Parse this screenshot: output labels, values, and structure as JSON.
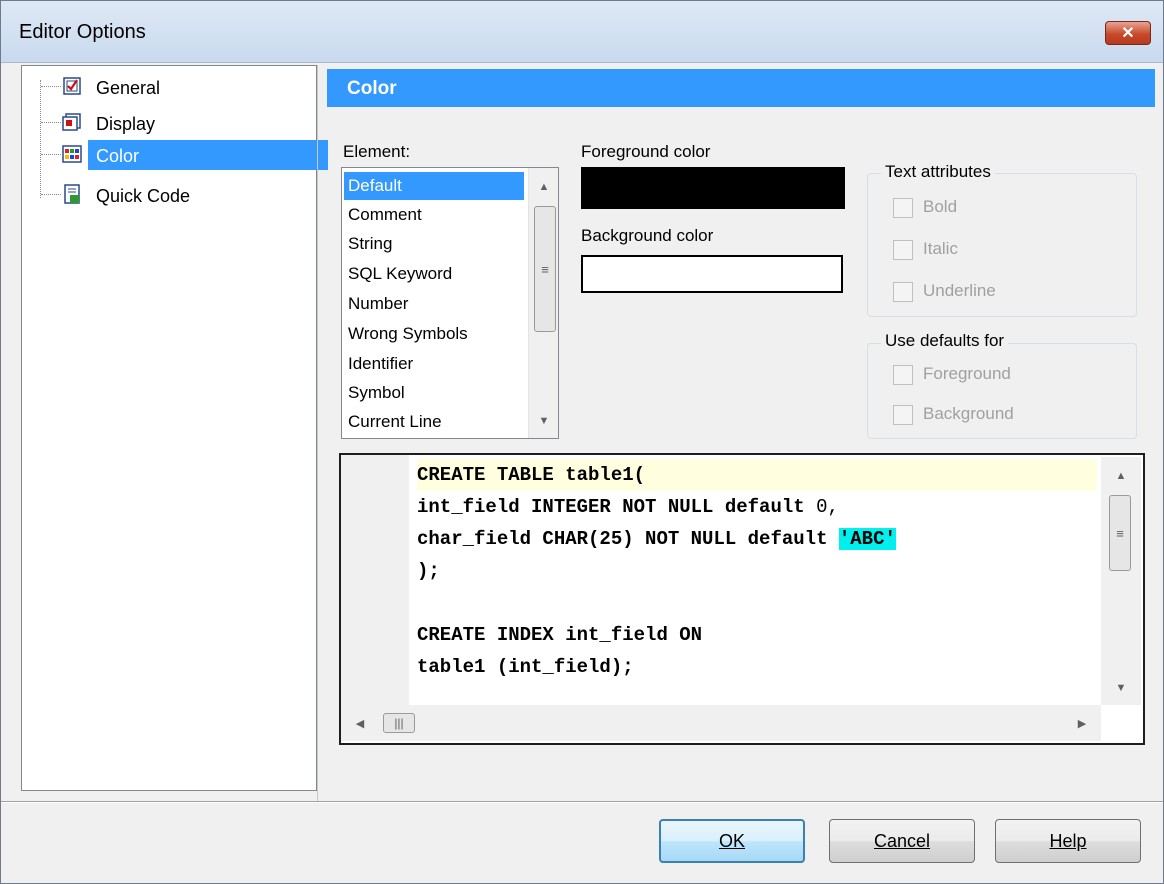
{
  "window": {
    "title": "Editor Options",
    "close_glyph": "✕"
  },
  "tree": {
    "items": [
      {
        "label": "General",
        "icon": "checkbox-page-icon"
      },
      {
        "label": "Display",
        "icon": "display-page-icon"
      },
      {
        "label": "Color",
        "icon": "color-grid-icon",
        "selected": true
      },
      {
        "label": "Quick Code",
        "icon": "quick-code-icon"
      }
    ]
  },
  "section": {
    "title": "Color"
  },
  "element": {
    "label": "Element:",
    "items": [
      "Default",
      "Comment",
      "String",
      "SQL Keyword",
      "Number",
      "Wrong Symbols",
      "Identifier",
      "Symbol",
      "Current Line"
    ],
    "selected": "Default"
  },
  "colors": {
    "foreground_label": "Foreground color",
    "background_label": "Background color",
    "foreground_value": "#000000",
    "background_value": "#ffffff"
  },
  "text_attributes": {
    "title": "Text attributes",
    "bold": "Bold",
    "italic": "Italic",
    "underline": "Underline"
  },
  "use_defaults": {
    "title": "Use defaults for",
    "foreground": "Foreground",
    "background": "Background"
  },
  "code": {
    "line1": "CREATE TABLE table1(",
    "line2_a": "int_field INTEGER NOT NULL default ",
    "line2_num": "0",
    "line2_b": ",",
    "line3_a": "char_field CHAR(25) NOT NULL default ",
    "line3_str": "'ABC'",
    "line4": ");",
    "line5": "",
    "line6": "CREATE INDEX int_field ON",
    "line7": "table1 (int_field);"
  },
  "buttons": {
    "ok": "OK",
    "cancel": "Cancel",
    "help": "Help"
  },
  "scroll": {
    "up": "▲",
    "down": "▼",
    "left": "◀",
    "right": "▶",
    "grip_v": "≡",
    "grip_h": "|||"
  }
}
